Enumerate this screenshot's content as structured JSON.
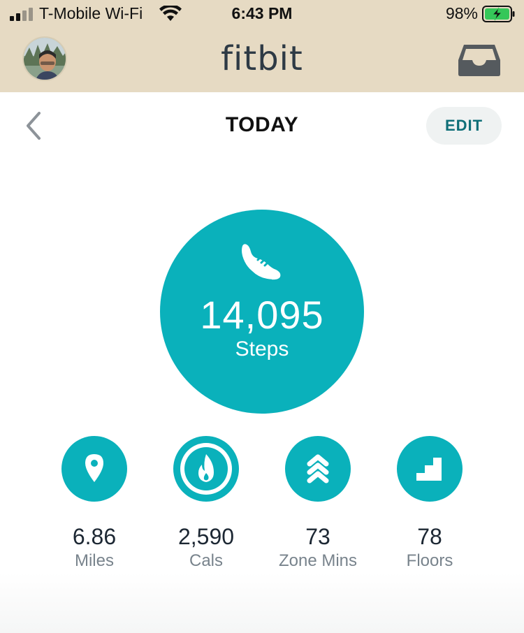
{
  "status_bar": {
    "carrier": "T-Mobile Wi-Fi",
    "time": "6:43 PM",
    "battery": "98%"
  },
  "header": {
    "brand": "fitbit",
    "avatar_icon": "user-avatar",
    "inbox_icon": "inbox-icon",
    "background_color": "#e6dac3"
  },
  "nav": {
    "title": "TODAY",
    "edit_label": "EDIT",
    "back_icon": "chevron-left-icon"
  },
  "steps": {
    "value": "14,095",
    "label": "Steps",
    "icon": "shoe-icon",
    "color": "#0ab1bb"
  },
  "stats": [
    {
      "value": "6.86",
      "label": "Miles",
      "icon": "location-pin-icon"
    },
    {
      "value": "2,590",
      "label": "Cals",
      "icon": "flame-icon"
    },
    {
      "value": "73",
      "label": "Zone Mins",
      "icon": "chevrons-up-icon"
    },
    {
      "value": "78",
      "label": "Floors",
      "icon": "stairs-icon"
    }
  ]
}
